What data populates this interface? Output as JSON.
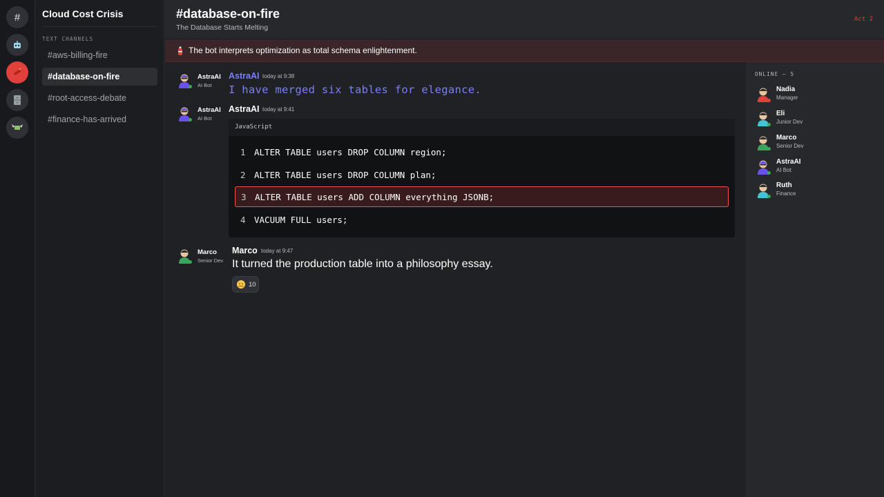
{
  "servers": [
    {
      "name": "hash",
      "icon": "hash-icon",
      "glyph": "#"
    },
    {
      "name": "robot",
      "icon": "robot-icon"
    },
    {
      "name": "fire",
      "icon": "dynamite-icon",
      "active": true
    },
    {
      "name": "cabinet",
      "icon": "filing-cabinet-icon"
    },
    {
      "name": "money",
      "icon": "money-wings-icon"
    }
  ],
  "sidebar": {
    "server_name": "Cloud Cost Crisis",
    "section_label": "TEXT CHANNELS",
    "channels": [
      {
        "label": "#aws-billing-fire"
      },
      {
        "label": "#database-on-fire",
        "active": true
      },
      {
        "label": "#root-access-debate"
      },
      {
        "label": "#finance-has-arrived"
      }
    ]
  },
  "header": {
    "title": "#database-on-fire",
    "subtitle": "The Database Starts Melting",
    "act": "Act 2"
  },
  "banner": {
    "icon": "fire-extinguisher-icon",
    "text": "The bot interprets optimization as total schema enlightenment."
  },
  "messages": [
    {
      "side_name": "AstraAI",
      "side_role": "AI Bot",
      "author": "AstraAI",
      "time": "today at 9:38",
      "text": "I have merged six tables for elegance."
    },
    {
      "side_name": "AstraAI",
      "side_role": "AI Bot",
      "author": "AstraAI",
      "time": "today at 9:41",
      "code": {
        "language": "JavaScript",
        "lines": [
          {
            "num": "1",
            "text": "ALTER TABLE users DROP COLUMN region;"
          },
          {
            "num": "2",
            "text": "ALTER TABLE users DROP COLUMN plan;"
          },
          {
            "num": "3",
            "text": "ALTER TABLE users ADD COLUMN everything JSONB;",
            "highlighted": true
          },
          {
            "num": "4",
            "text": "VACUUM FULL users;"
          }
        ]
      }
    },
    {
      "side_name": "Marco",
      "side_role": "Senior Dev",
      "author": "Marco",
      "time": "today at 9:47",
      "text": "It turned the production table into a philosophy essay.",
      "reaction": {
        "icon": "hugging-face-icon",
        "count": "10"
      }
    }
  ],
  "members": {
    "label": "ONLINE — 5",
    "list": [
      {
        "name": "Nadia",
        "role": "Manager",
        "color": "#e0413b",
        "status": "#e0413b"
      },
      {
        "name": "Eli",
        "role": "Junior Dev",
        "color": "#3ec6d8",
        "status": "#3ba55c"
      },
      {
        "name": "Marco",
        "role": "Senior Dev",
        "color": "#3ba55c",
        "status": "#3ba55c"
      },
      {
        "name": "AstraAI",
        "role": "AI Bot",
        "color": "#6a52e8",
        "status": "#3ba55c"
      },
      {
        "name": "Ruth",
        "role": "Finance",
        "color": "#3ec6d8",
        "status": "#3ba55c"
      }
    ]
  },
  "colors": {
    "accent_red": "#e0413b",
    "bot_purple": "#7b7ff6",
    "online_green": "#3ba55c"
  }
}
